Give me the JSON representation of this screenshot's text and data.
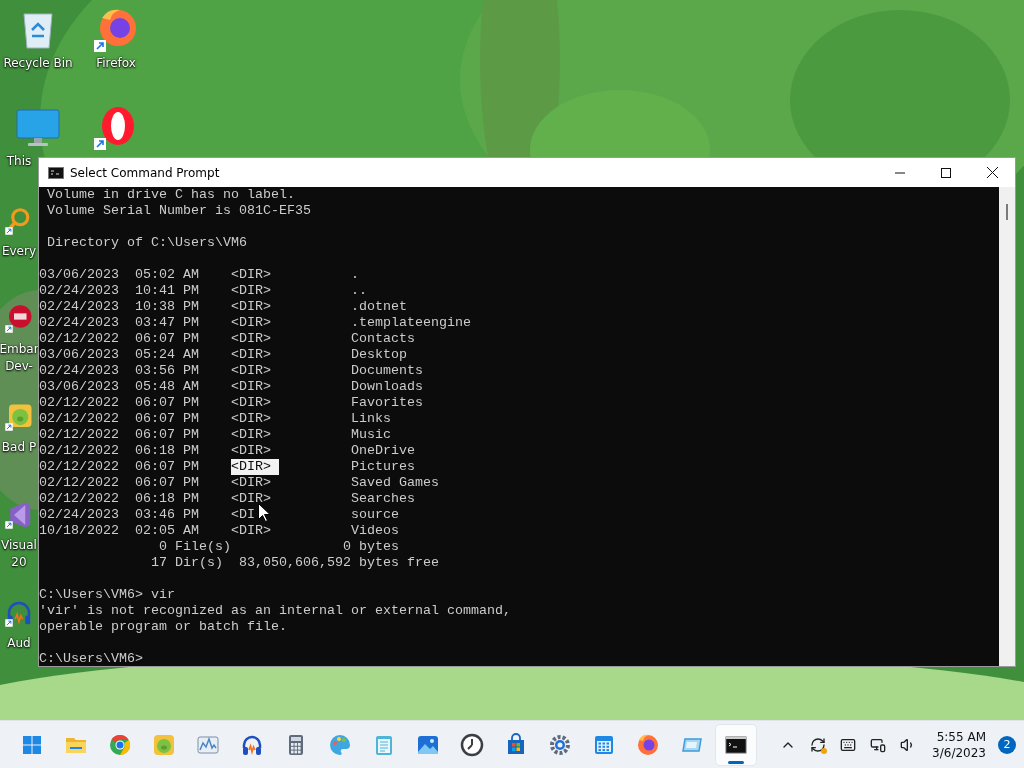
{
  "desktop": {
    "columns": [
      [
        {
          "kind": "recycle-bin",
          "label_lines": [
            "Recycle Bin"
          ]
        },
        {
          "kind": "monitor",
          "label_lines": [
            "This"
          ]
        },
        {
          "kind": "magnifier",
          "label_lines": [
            "Every"
          ]
        },
        {
          "kind": "red-badge",
          "label_lines": [
            "Embar",
            "Dev-"
          ]
        },
        {
          "kind": "pig",
          "label_lines": [
            "Bad P"
          ]
        },
        {
          "kind": "purple-ribbon",
          "label_lines": [
            "Visual",
            "20"
          ]
        },
        {
          "kind": "headphones",
          "label_lines": [
            "Aud"
          ]
        }
      ],
      [
        {
          "kind": "firefox",
          "label_lines": [
            "Firefox"
          ]
        },
        {
          "kind": "opera"
        }
      ]
    ]
  },
  "window": {
    "title": "Select Command Prompt",
    "lines": [
      {
        "kind": "text",
        "text": " Volume in drive C has no label."
      },
      {
        "kind": "text",
        "text": " Volume Serial Number is 081C-EF35"
      },
      {
        "kind": "blank"
      },
      {
        "kind": "text",
        "text": " Directory of C:\\Users\\VM6"
      },
      {
        "kind": "blank"
      },
      {
        "kind": "entry",
        "date": "03/06/2023",
        "time": "05:02 AM",
        "type": "<DIR>",
        "name": ".",
        "selected": false
      },
      {
        "kind": "entry",
        "date": "02/24/2023",
        "time": "10:41 PM",
        "type": "<DIR>",
        "name": "..",
        "selected": false
      },
      {
        "kind": "entry",
        "date": "02/24/2023",
        "time": "10:38 PM",
        "type": "<DIR>",
        "name": ".dotnet",
        "selected": false
      },
      {
        "kind": "entry",
        "date": "02/24/2023",
        "time": "03:47 PM",
        "type": "<DIR>",
        "name": ".templateengine",
        "selected": false
      },
      {
        "kind": "entry",
        "date": "02/12/2022",
        "time": "06:07 PM",
        "type": "<DIR>",
        "name": "Contacts",
        "selected": false
      },
      {
        "kind": "entry",
        "date": "03/06/2023",
        "time": "05:24 AM",
        "type": "<DIR>",
        "name": "Desktop",
        "selected": false
      },
      {
        "kind": "entry",
        "date": "02/24/2023",
        "time": "03:56 PM",
        "type": "<DIR>",
        "name": "Documents",
        "selected": false
      },
      {
        "kind": "entry",
        "date": "03/06/2023",
        "time": "05:48 AM",
        "type": "<DIR>",
        "name": "Downloads",
        "selected": false
      },
      {
        "kind": "entry",
        "date": "02/12/2022",
        "time": "06:07 PM",
        "type": "<DIR>",
        "name": "Favorites",
        "selected": false
      },
      {
        "kind": "entry",
        "date": "02/12/2022",
        "time": "06:07 PM",
        "type": "<DIR>",
        "name": "Links",
        "selected": false
      },
      {
        "kind": "entry",
        "date": "02/12/2022",
        "time": "06:07 PM",
        "type": "<DIR>",
        "name": "Music",
        "selected": false
      },
      {
        "kind": "entry",
        "date": "02/12/2022",
        "time": "06:18 PM",
        "type": "<DIR>",
        "name": "OneDrive",
        "selected": false
      },
      {
        "kind": "entry",
        "date": "02/12/2022",
        "time": "06:07 PM",
        "type": "<DIR>",
        "name": "Pictures",
        "selected": true
      },
      {
        "kind": "entry",
        "date": "02/12/2022",
        "time": "06:07 PM",
        "type": "<DIR>",
        "name": "Saved Games",
        "selected": false
      },
      {
        "kind": "entry",
        "date": "02/12/2022",
        "time": "06:18 PM",
        "type": "<DIR>",
        "name": "Searches",
        "selected": false
      },
      {
        "kind": "entry",
        "date": "02/24/2023",
        "time": "03:46 PM",
        "type": "<DI",
        "name": "source",
        "selected": false
      },
      {
        "kind": "entry",
        "date": "10/18/2022",
        "time": "02:05 AM",
        "type": "<DIR>",
        "name": "Videos",
        "selected": false
      },
      {
        "kind": "text",
        "text": "               0 File(s)              0 bytes"
      },
      {
        "kind": "text",
        "text": "              17 Dir(s)  83,050,606,592 bytes free"
      },
      {
        "kind": "blank"
      },
      {
        "kind": "text",
        "text": "C:\\Users\\VM6> vir"
      },
      {
        "kind": "text",
        "text": "'vir' is not recognized as an internal or external command,"
      },
      {
        "kind": "text",
        "text": "operable program or batch file."
      },
      {
        "kind": "blank"
      },
      {
        "kind": "text",
        "text": "C:\\Users\\VM6>"
      }
    ]
  },
  "taskbar": {
    "apps": [
      {
        "kind": "start",
        "selected": false
      },
      {
        "kind": "folder",
        "selected": false
      },
      {
        "kind": "chrome",
        "selected": false
      },
      {
        "kind": "pig",
        "selected": false
      },
      {
        "kind": "chart",
        "selected": false
      },
      {
        "kind": "headphones",
        "selected": false
      },
      {
        "kind": "calculator",
        "selected": false
      },
      {
        "kind": "palette",
        "selected": false
      },
      {
        "kind": "notepad",
        "selected": false
      },
      {
        "kind": "photos",
        "selected": false
      },
      {
        "kind": "clock",
        "selected": false
      },
      {
        "kind": "store",
        "selected": false
      },
      {
        "kind": "gear",
        "selected": false
      },
      {
        "kind": "calendar",
        "selected": false
      },
      {
        "kind": "firefox",
        "selected": false
      },
      {
        "kind": "tablet",
        "selected": false
      },
      {
        "kind": "terminal",
        "selected": true
      }
    ],
    "clock": {
      "time": "5:55 AM",
      "date": "3/6/2023"
    },
    "notifications": "2"
  }
}
